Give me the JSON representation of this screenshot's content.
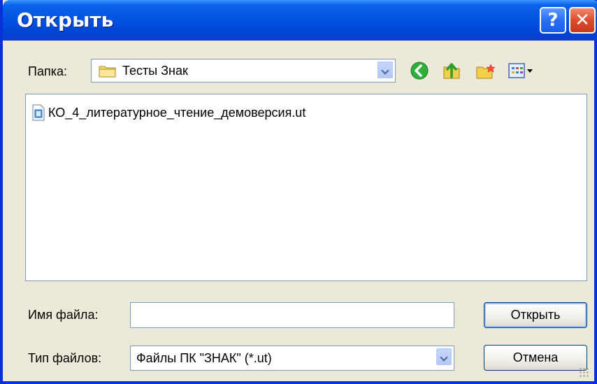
{
  "window": {
    "title": "Открыть"
  },
  "titlebar": {
    "help_label": "?",
    "close_label": "✕"
  },
  "look_in": {
    "label": "Папка:",
    "value": "Тесты Знак"
  },
  "files": [
    {
      "name": "КО_4_литературное_чтение_демоверсия.ut",
      "icon": "file-icon"
    }
  ],
  "filename": {
    "label": "Имя файла:",
    "value": ""
  },
  "filetype": {
    "label": "Тип файлов:",
    "value": "Файлы ПК \"ЗНАК\" (*.ut)"
  },
  "buttons": {
    "open_label": "Открыть",
    "cancel_label": "Отмена"
  },
  "colors": {
    "titlebar": "#0054e3",
    "window_bg": "#ece9d8",
    "border": "#7f9db9"
  }
}
